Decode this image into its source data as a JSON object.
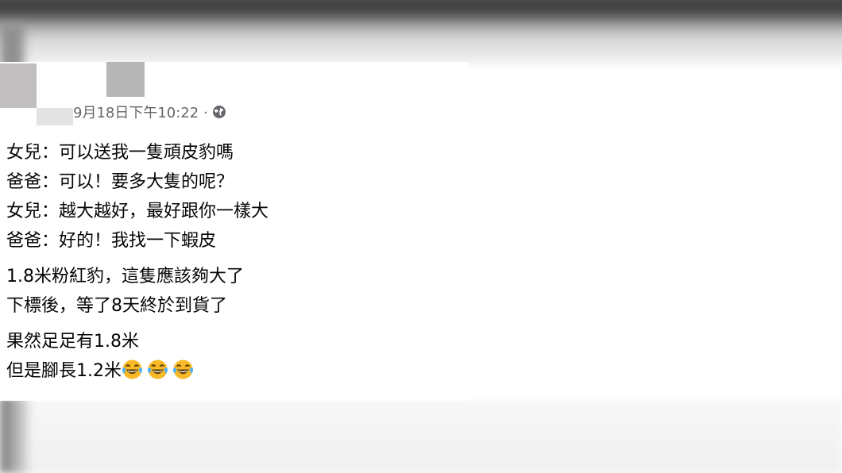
{
  "post": {
    "timestamp": "9月18日下午10:22 ·",
    "privacy_icon": "globe-icon",
    "paragraphs": [
      [
        "女兒：可以送我一隻頑皮豹嗎",
        "爸爸：可以！要多大隻的呢？",
        "女兒：越大越好，最好跟你一樣大",
        "爸爸：好的！我找一下蝦皮"
      ],
      [
        "1.8米粉紅豹，這隻應該夠大了",
        "下標後，等了8天終於到貨了"
      ],
      [
        "果然足足有1.8米",
        "但是腳長1.2米"
      ]
    ],
    "emoji": [
      "laughing-crying-emoji",
      "laughing-crying-emoji",
      "laughing-crying-emoji"
    ]
  }
}
